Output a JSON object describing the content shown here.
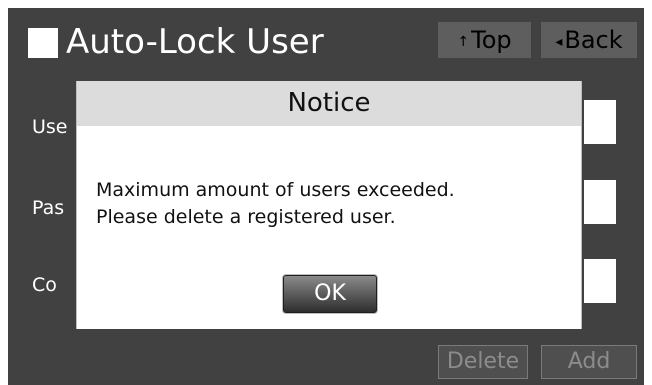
{
  "header": {
    "title": "Auto-Lock User",
    "top_button": {
      "arrow": "↑",
      "label": "Top"
    },
    "back_button": {
      "arrow": "◂",
      "label": "Back"
    }
  },
  "form": {
    "rows": [
      {
        "label_visible": "Use"
      },
      {
        "label_visible": "Pas"
      },
      {
        "label_visible": "Co"
      }
    ]
  },
  "footer": {
    "delete_label": "Delete",
    "add_label": "Add"
  },
  "dialog": {
    "title": "Notice",
    "message_lines": [
      "Maximum amount of users exceeded.",
      "Please delete a registered user."
    ],
    "ok_label": "OK"
  },
  "colors": {
    "screen_bg": "#414141",
    "header_button_bg": "#5e5e5e",
    "dialog_header_bg": "#dcdcdc",
    "dialog_bg": "#ffffff"
  },
  "icons": {
    "title_icon": "white-square-icon",
    "top_arrow": "up-arrow-icon",
    "back_arrow": "left-triangle-icon"
  }
}
